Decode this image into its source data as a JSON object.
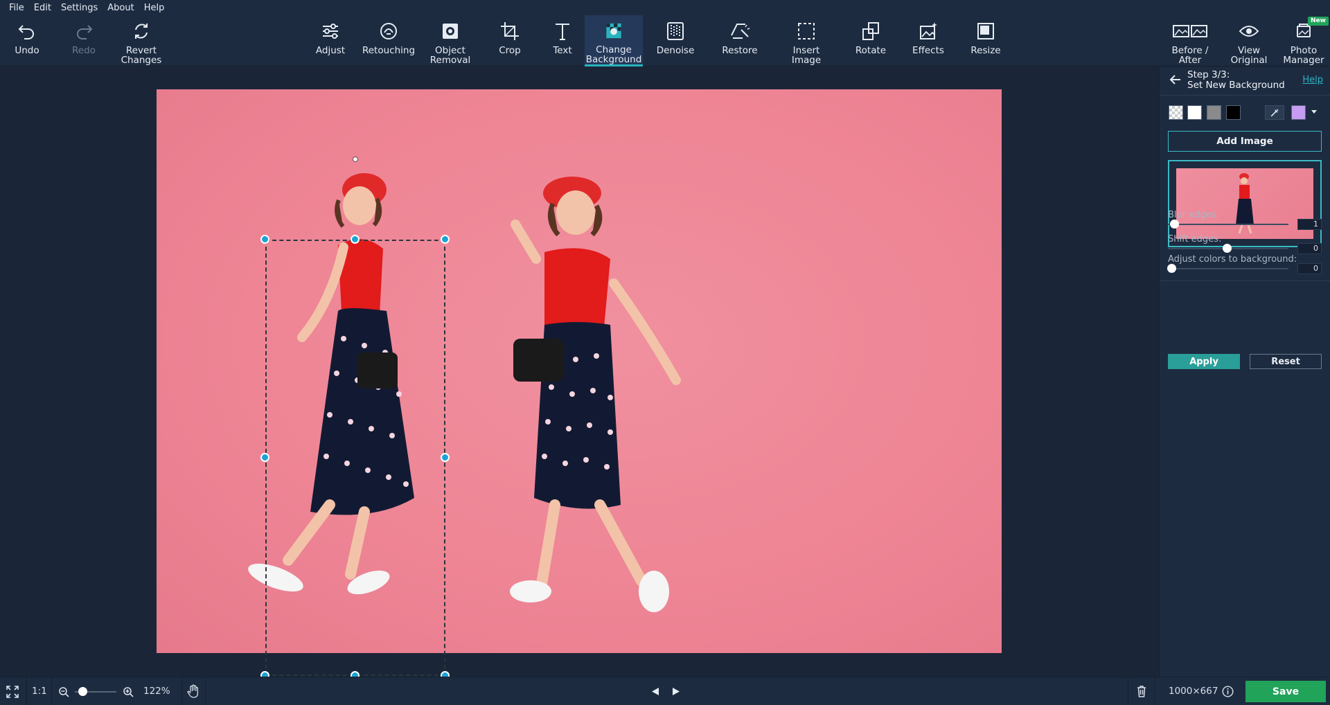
{
  "menu": [
    "File",
    "Edit",
    "Settings",
    "About",
    "Help"
  ],
  "toolbar": {
    "undo": "Undo",
    "redo": "Redo",
    "revert": "Revert\nChanges",
    "adjust": "Adjust",
    "retouching": "Retouching",
    "object_removal": "Object\nRemoval",
    "crop": "Crop",
    "text": "Text",
    "change_background": "Change\nBackground",
    "denoise": "Denoise",
    "restore": "Restore",
    "insert_image": "Insert\nImage",
    "rotate": "Rotate",
    "effects": "Effects",
    "resize": "Resize",
    "before_after": "Before /\nAfter",
    "view_original": "View\nOriginal",
    "photo_manager": "Photo\nManager",
    "new_badge": "New"
  },
  "panel": {
    "step_line1": "Step 3/3:",
    "step_line2": "Set New Background",
    "help": "Help",
    "swatches": [
      "transparent",
      "#ffffff",
      "#8a8a8a",
      "#000000"
    ],
    "picked_color": "#c59cf2",
    "add_image": "Add Image",
    "blur_label": "Blur edges:",
    "blur_value": "1",
    "shift_label": "Shift edges:",
    "shift_value": "0",
    "adjust_label": "Adjust colors to background:",
    "adjust_value": "0",
    "apply": "Apply",
    "reset": "Reset"
  },
  "status": {
    "ratio": "1:1",
    "zoom": "122%",
    "dimensions": "1000×667",
    "save": "Save"
  },
  "colors": {
    "accent": "#28b3bd",
    "save": "#22a35a",
    "apply": "#2a9e98",
    "background": "#ee8595"
  }
}
